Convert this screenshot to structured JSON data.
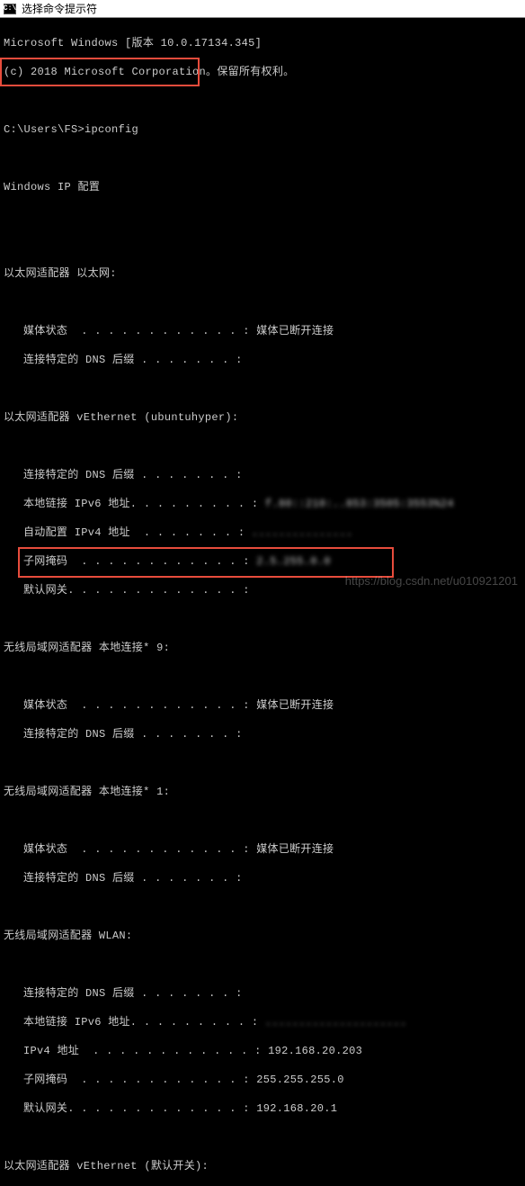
{
  "title_bar": {
    "icon_label": "C:\\",
    "title": "选择命令提示符"
  },
  "header": {
    "line1": "Microsoft Windows [版本 10.0.17134.345]",
    "line2": "(c) 2018 Microsoft Corporation。保留所有权利。"
  },
  "prompt": {
    "path": "C:\\Users\\FS>",
    "command": "ipconfig"
  },
  "config_title": "Windows IP 配置",
  "adapters": {
    "ethernet": {
      "title": "以太网适配器 以太网:",
      "media_state_label": "媒体状态 ",
      "media_state_value": " 媒体已断开连接",
      "dns_suffix_label": "连接特定的 DNS 后缀",
      "dns_suffix_value": ""
    },
    "vethernet": {
      "title": "以太网适配器 vEthernet (ubuntuhyper):",
      "dns_suffix_label": "连接特定的 DNS 后缀",
      "dns_suffix_value": "",
      "ipv6_label": "本地链接 IPv6 地址.",
      "ipv6_value_hidden": " f.80::210:..853:3505:3553%24",
      "autoconfig_label": "自动配置 IPv4 地址 ",
      "autoconfig_value_hidden": " ...............",
      "subnet_label": "子网掩码 ",
      "subnet_value_hidden": " 2.5.255.0.0",
      "gateway_label": "默认网关.",
      "gateway_value": ""
    },
    "wlan_local9": {
      "title": "无线局域网适配器 本地连接* 9:",
      "media_state_label": "媒体状态 ",
      "media_state_value": " 媒体已断开连接",
      "dns_suffix_label": "连接特定的 DNS 后缀",
      "dns_suffix_value": ""
    },
    "wlan_local1": {
      "title": "无线局域网适配器 本地连接* 1:",
      "media_state_label": "媒体状态 ",
      "media_state_value": " 媒体已断开连接",
      "dns_suffix_label": "连接特定的 DNS 后缀",
      "dns_suffix_value": ""
    },
    "wlan": {
      "title": "无线局域网适配器 WLAN:",
      "dns_suffix_label": "连接特定的 DNS 后缀",
      "dns_suffix_value": "",
      "ipv6_label": "本地链接 IPv6 地址.",
      "ipv6_value_hidden": " .....................",
      "ipv4_label": "IPv4 地址",
      "ipv4_value": " 192.168.20.203",
      "subnet_label": "子网掩码 ",
      "subnet_value": " 255.255.255.0",
      "gateway_label": "默认网关.",
      "gateway_value": " 192.168.20.1"
    },
    "vethernet2": {
      "title": "以太网适配器 vEthernet (默认开关):"
    }
  },
  "watermark": "https://blog.csdn.net/u010921201"
}
